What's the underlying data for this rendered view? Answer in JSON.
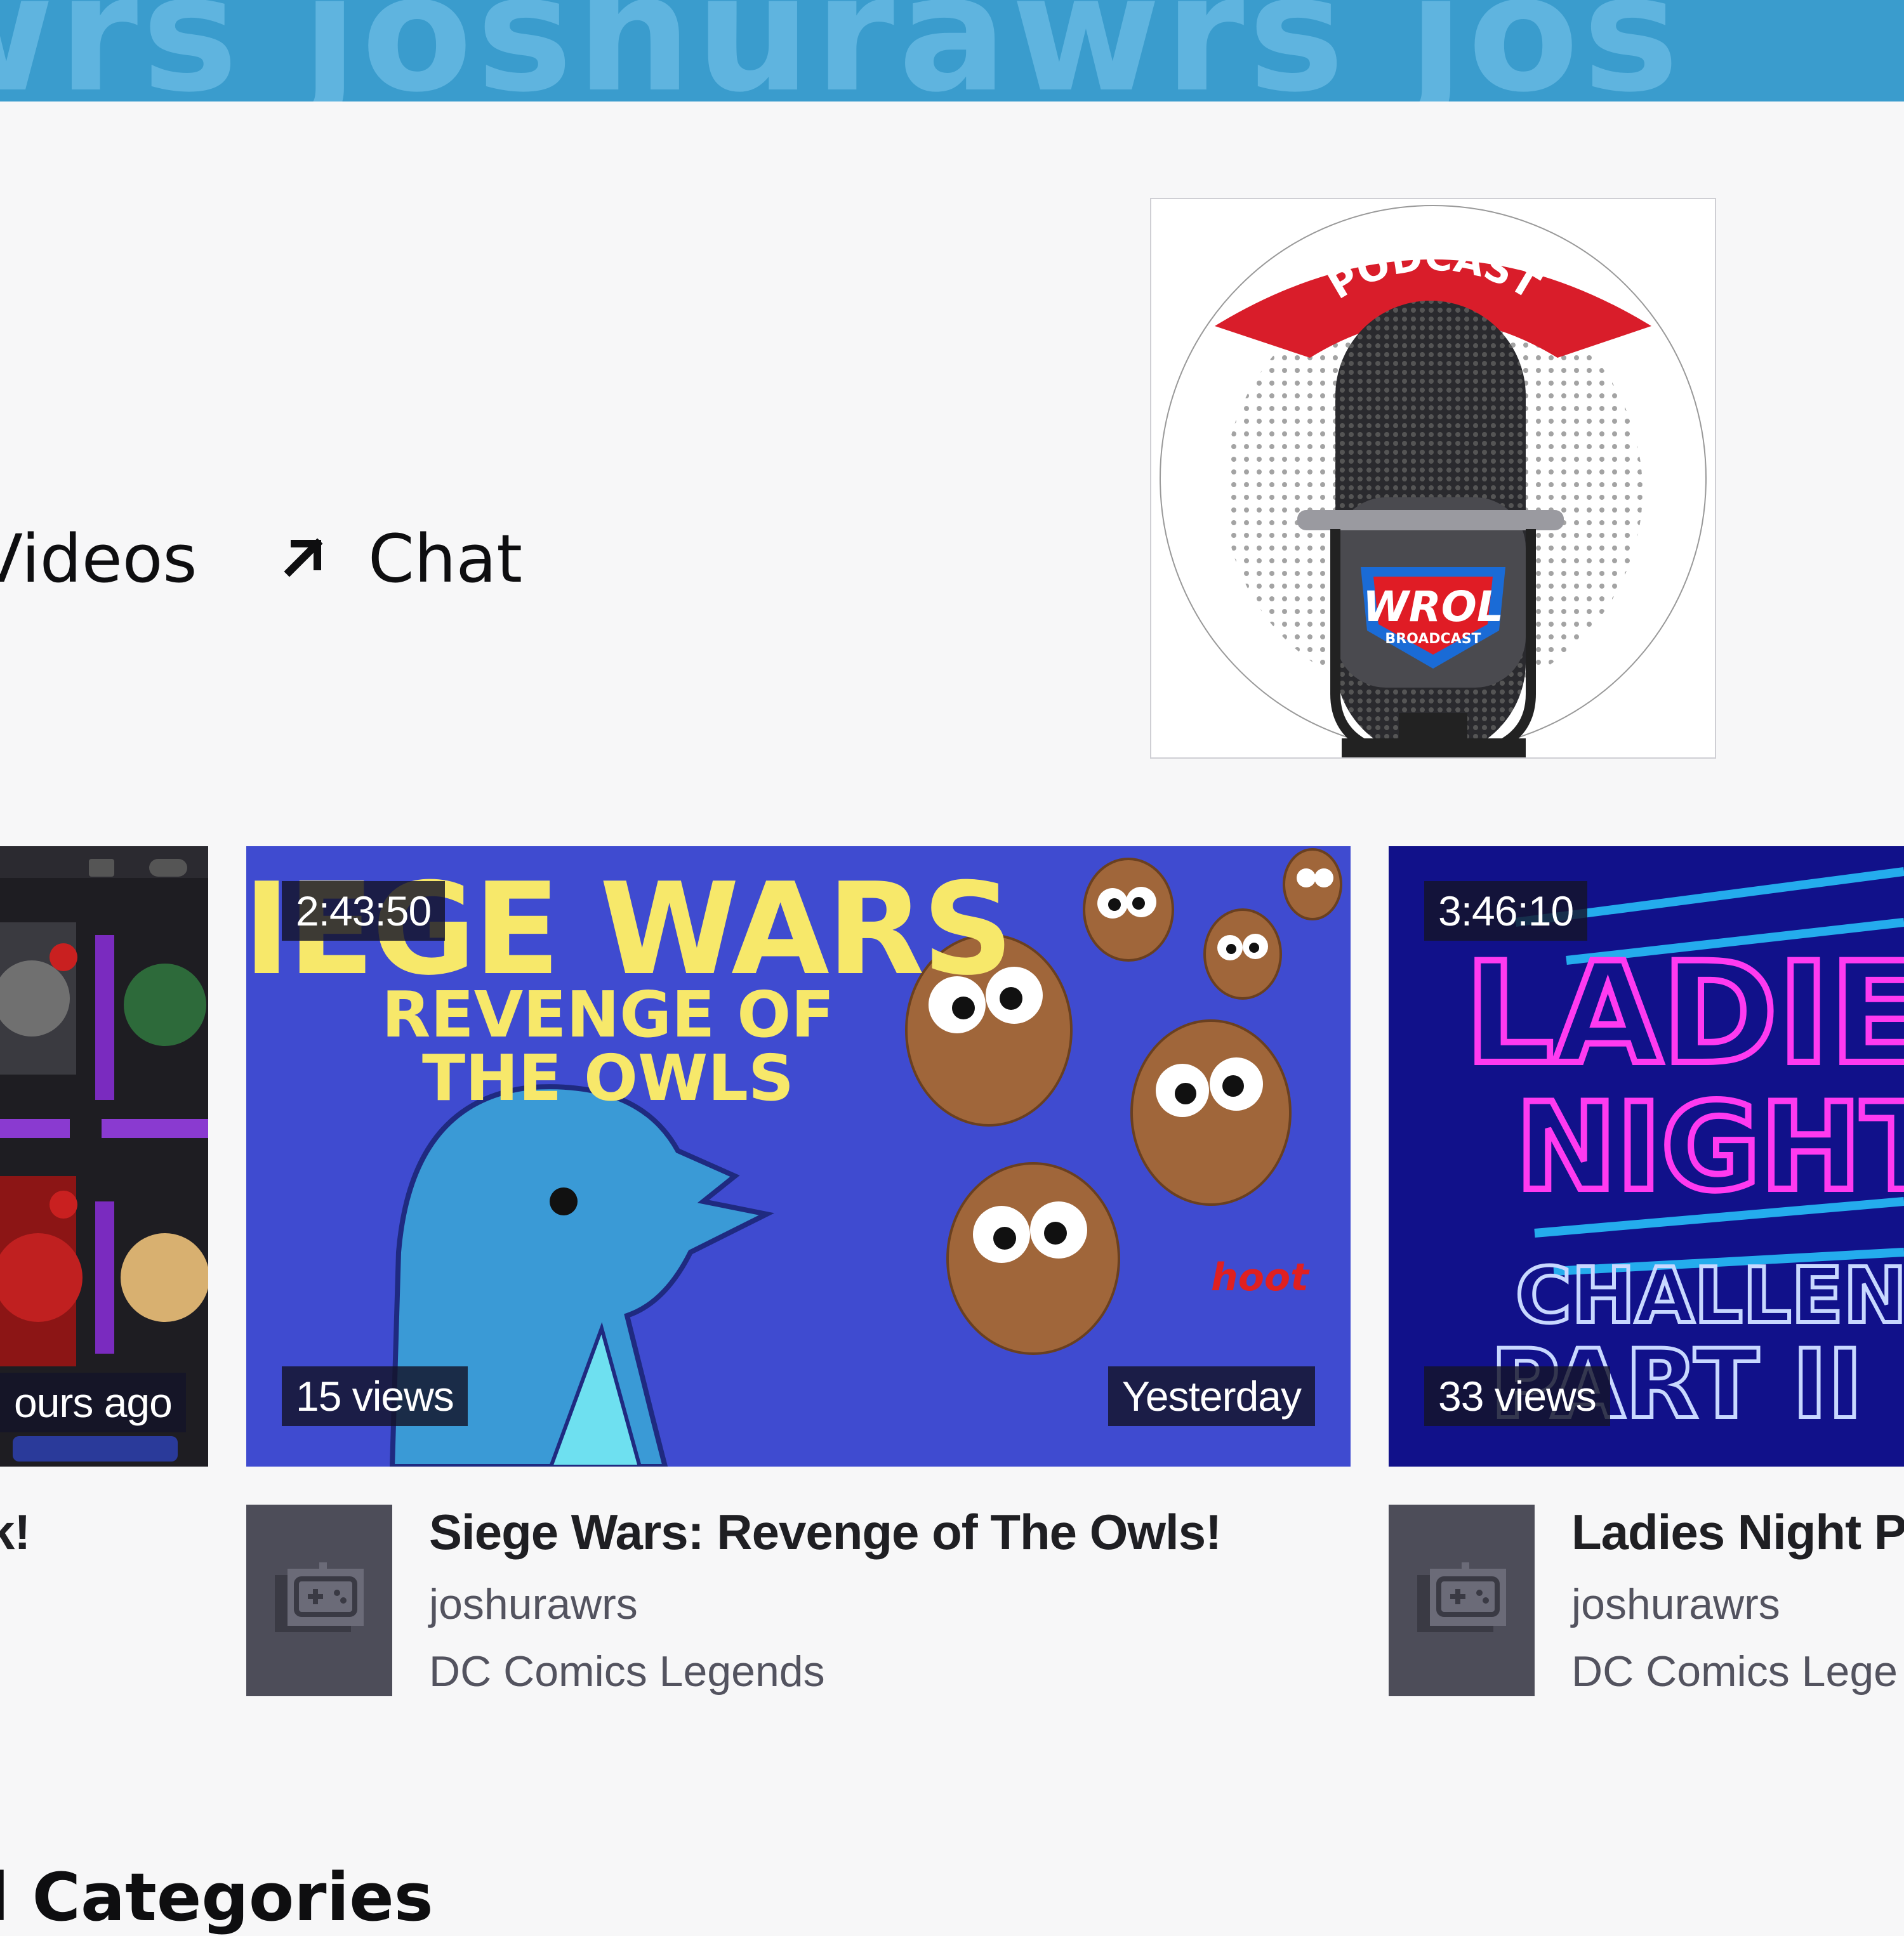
{
  "banner": {
    "text": "wrs joshurawrs jos"
  },
  "nav": {
    "videos_label": "Videos",
    "chat_label": "Chat",
    "chat_icon": "arrow-up-right-icon"
  },
  "podcast_panel": {
    "arc_text": "PODCAST",
    "logo_text": "WROL",
    "logo_subtext": "BROADCAST"
  },
  "videos": [
    {
      "thumbnail_time_ago": "ours ago",
      "title": "k!"
    },
    {
      "duration": "2:43:50",
      "views": "15 views",
      "date": "Yesterday",
      "thumb_line1": "SIEGE WARS",
      "thumb_line2": "REVENGE OF",
      "thumb_line3": "THE OWLS",
      "thumb_hoot": "hoot",
      "title": "Siege Wars: Revenge of The Owls!",
      "channel": "joshurawrs",
      "category": "DC Comics Legends"
    },
    {
      "duration": "3:46:10",
      "views": "33 views",
      "thumb_line1": "LADIES",
      "thumb_line2": "NIGHT",
      "thumb_line3": "CHALLENGE",
      "thumb_line4": "PART II",
      "title": "Ladies Night P",
      "channel": "joshurawrs",
      "category": "DC Comics Lege"
    }
  ],
  "section": {
    "heading": "d Categories"
  },
  "colors": {
    "banner": "#3a9ccd",
    "siege_bg": "#3f4bd0",
    "ladies_bg": "#11118a",
    "avatar_bg": "#4d4d59"
  },
  "icons": [
    "arrow-up-right-icon",
    "gamepad-icon",
    "microphone-icon"
  ]
}
